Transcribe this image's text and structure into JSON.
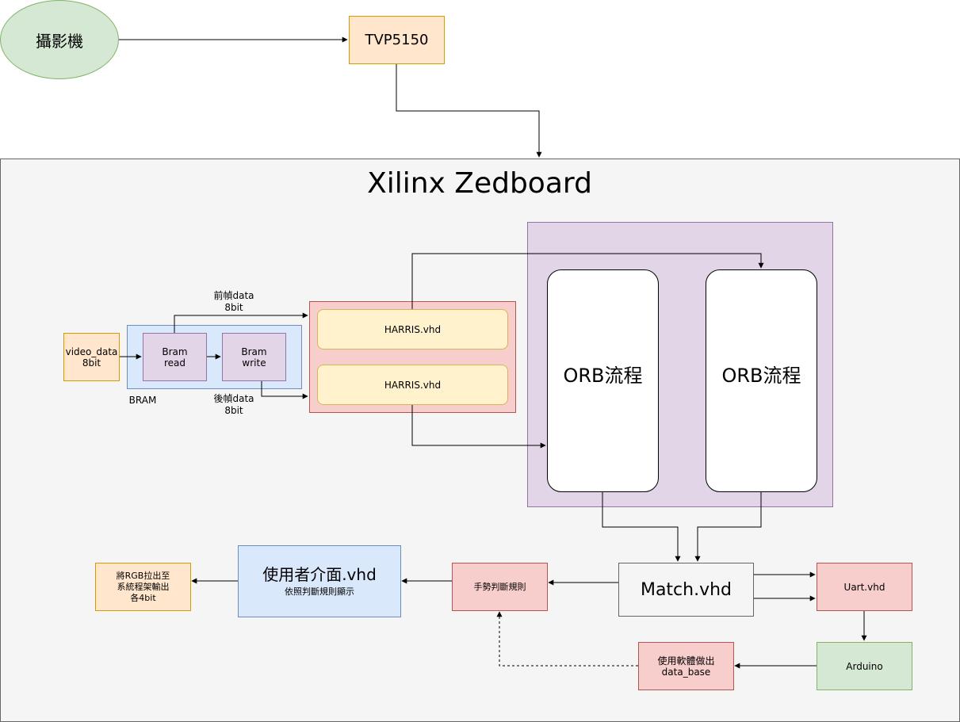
{
  "camera": {
    "label": "攝影機"
  },
  "decoder": {
    "label": "TVP5150"
  },
  "board": {
    "title": "Xilinx Zedboard"
  },
  "video_input": {
    "line1": "video_data",
    "line2": "8bit"
  },
  "bram": {
    "label": "BRAM",
    "read": {
      "line1": "Bram",
      "line2": "read"
    },
    "write": {
      "line1": "Bram",
      "line2": "write"
    }
  },
  "prev_frame": {
    "line1": "前幀data",
    "line2": "8bit"
  },
  "next_frame": {
    "line1": "後幀data",
    "line2": "8bit"
  },
  "harris": [
    {
      "label": "HARRIS.vhd"
    },
    {
      "label": "HARRIS.vhd"
    }
  ],
  "orb": [
    {
      "label": "ORB流程"
    },
    {
      "label": "ORB流程"
    }
  ],
  "match": {
    "label": "Match.vhd"
  },
  "uart": {
    "label": "Uart.vhd"
  },
  "arduino": {
    "label": "Arduino"
  },
  "database": {
    "line1": "使用軟體做出",
    "line2": "data_base"
  },
  "gesture": {
    "label": "手勢判斷規則"
  },
  "ui": {
    "title": "使用者介面.vhd",
    "subtitle": "依照判斷規則顯示"
  },
  "vga_output": {
    "line1": "將RGB拉出至",
    "line2": "系統程架輸出",
    "line3": "各4bit"
  },
  "colors": {
    "camera_fill": "#d5e8d4",
    "camera_stroke": "#82b366",
    "orange_fill": "#ffe6cc",
    "orange_stroke": "#d79b00",
    "board_fill": "#f5f5f5",
    "board_stroke": "#666666",
    "blue_fill": "#dae8fc",
    "blue_stroke": "#6c8ebf",
    "purple_fill": "#e1d5e7",
    "purple_stroke": "#9673a6",
    "red_fill": "#f8cecc",
    "red_stroke": "#b85450",
    "yellow_fill": "#fff2cc",
    "yellow_stroke": "#d6b656"
  }
}
